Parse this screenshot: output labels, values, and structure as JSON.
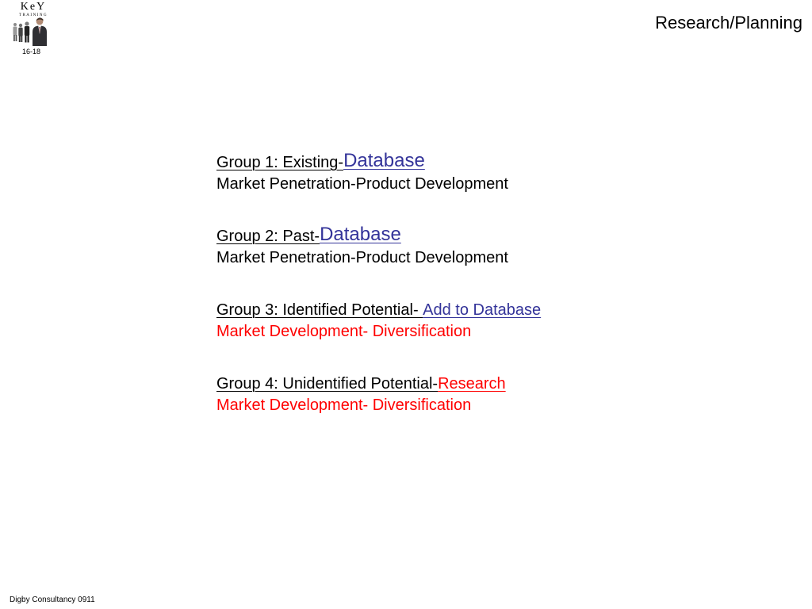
{
  "slide": {
    "title": "Research/Planning",
    "number": "16-18",
    "footer": "Digby Consultancy 0911"
  },
  "logo": {
    "icon": "people-figures-icon",
    "word": "KeY",
    "subword": "TRAINING"
  },
  "colors": {
    "link_blue": "#333399",
    "accent_red": "#ff0000",
    "text": "#000000"
  },
  "groups": [
    {
      "label": "Group 1: Existing-",
      "action": "Database",
      "action_color": "#333399",
      "strategy": "Market Penetration-Product Development",
      "strategy_color": "#000000"
    },
    {
      "label": "Group 2: Past-",
      "action": "Database",
      "action_color": "#333399",
      "strategy": "Market Penetration-Product Development",
      "strategy_color": "#000000"
    },
    {
      "label": "Group 3: Identified Potential- ",
      "action": "Add to Database",
      "action_color": "#333399",
      "strategy": "Market Development- Diversification",
      "strategy_color": "#ff0000"
    },
    {
      "label": "Group 4: Unidentified Potential-",
      "action": "Research",
      "action_color": "#ff0000",
      "strategy": "Market Development- Diversification",
      "strategy_color": "#ff0000"
    }
  ]
}
